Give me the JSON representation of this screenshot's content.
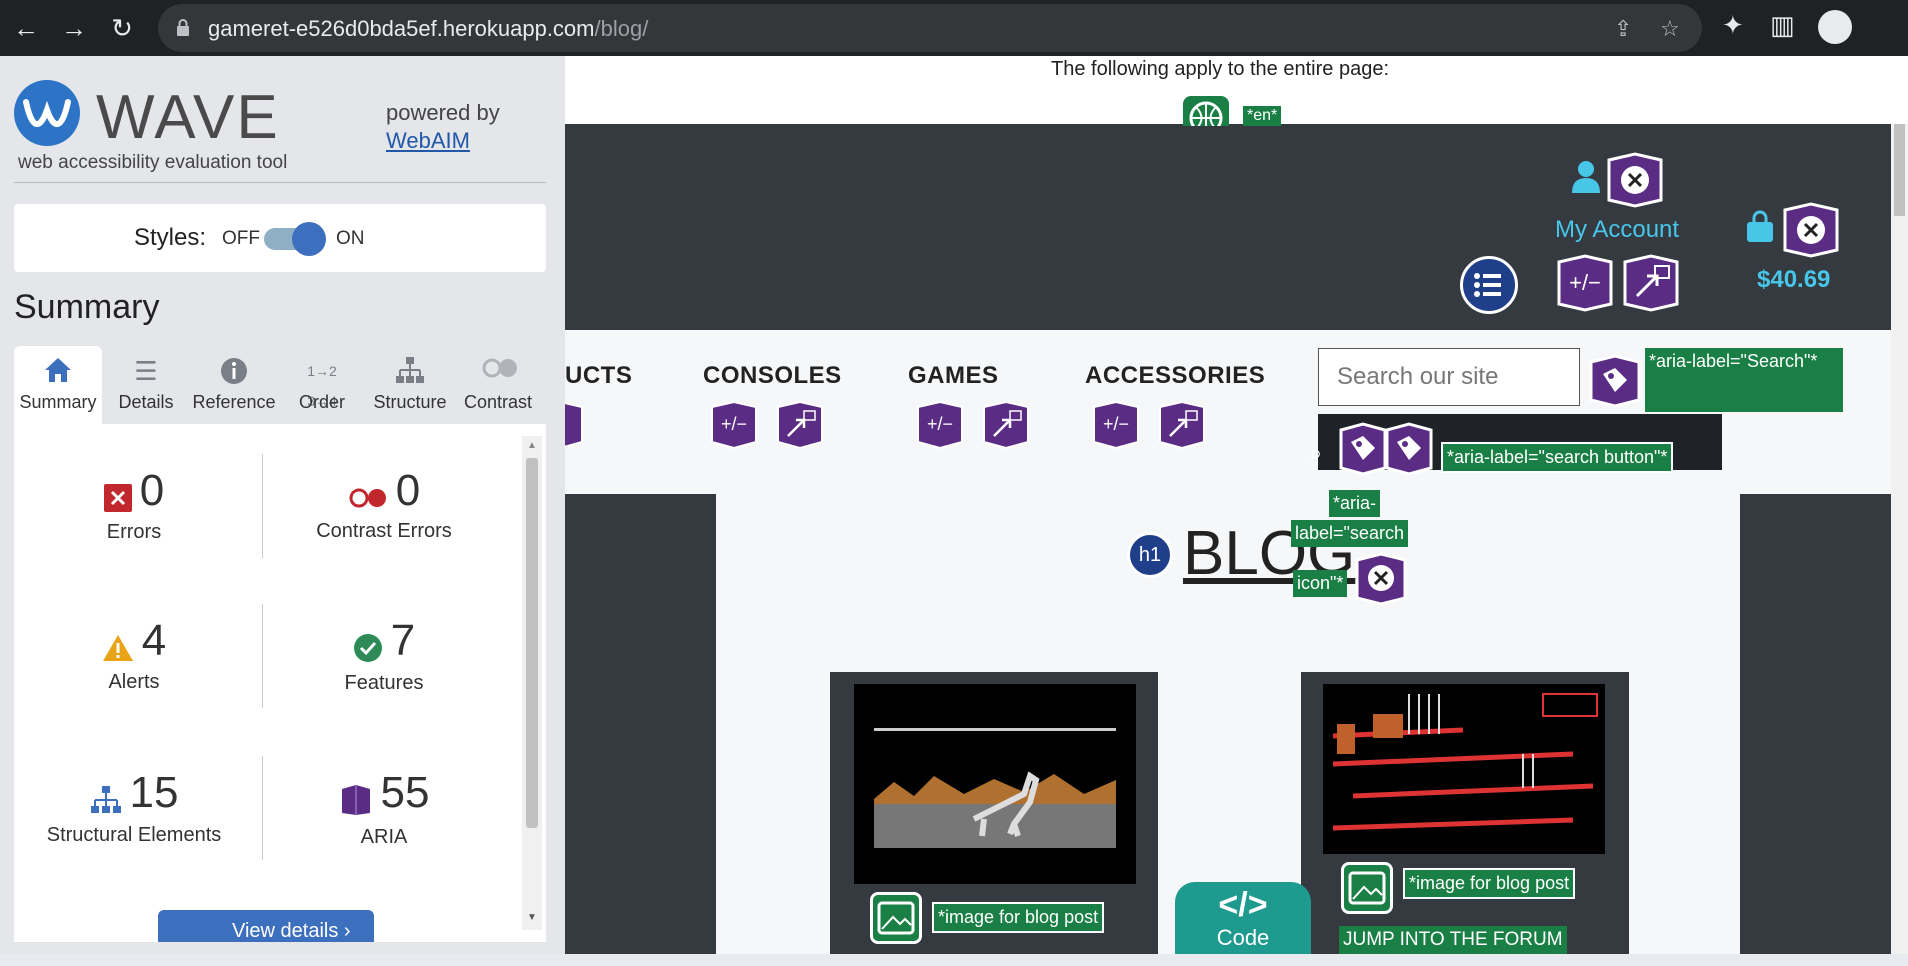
{
  "browser": {
    "url_host": "gameret-e526d0bda5ef.herokuapp.com",
    "url_path": "/blog/"
  },
  "wave": {
    "title": "WAVE",
    "subtitle": "web accessibility evaluation tool",
    "powered_by": "powered by",
    "webaim_link": "WebAIM",
    "styles_label": "Styles:",
    "styles_off": "OFF",
    "styles_on": "ON",
    "styles_state": "on",
    "summary_heading": "Summary",
    "tabs": [
      {
        "label": "Summary",
        "icon": "home-icon",
        "active": true
      },
      {
        "label": "Details",
        "icon": "list-icon",
        "active": false
      },
      {
        "label": "Reference",
        "icon": "info-icon",
        "active": false
      },
      {
        "label": "Order",
        "icon": "order-icon",
        "active": false
      },
      {
        "label": "Structure",
        "icon": "structure-icon",
        "active": false
      },
      {
        "label": "Contrast",
        "icon": "contrast-icon",
        "active": false
      }
    ],
    "stats": {
      "errors": {
        "count": "0",
        "label": "Errors",
        "color": "#c0282d"
      },
      "contrast_errors": {
        "count": "0",
        "label": "Contrast Errors",
        "color": "#c0282d"
      },
      "alerts": {
        "count": "4",
        "label": "Alerts",
        "color": "#e8a317"
      },
      "features": {
        "count": "7",
        "label": "Features",
        "color": "#2e8b57"
      },
      "structural": {
        "count": "15",
        "label": "Structural Elements",
        "color": "#3d6fbf"
      },
      "aria": {
        "count": "55",
        "label": "ARIA",
        "color": "#5b2c83"
      }
    },
    "view_details": "View details ›"
  },
  "page": {
    "entire_page_note": "The following apply to the entire page:",
    "lang_label": "*en*",
    "account_label": "My Account",
    "cart_total": "$40.69",
    "menu": [
      "UCTS",
      "CONSOLES",
      "GAMES",
      "ACCESSORIES"
    ],
    "search_placeholder": "Search our site",
    "aria_search": "*aria-label=\"Search\"*",
    "aria_search_button": "*aria-label=\"search button\"*",
    "aria_search_icon_1": "*aria-",
    "aria_search_icon_2": "label=\"search",
    "aria_search_icon_3": "icon\"*",
    "heading_level": "h1",
    "heading": "BLOG",
    "card1_alt": "*image for blog post",
    "card2_alt": "*image for blog post",
    "card2_title": "JUMP INTO THE FORUM",
    "code_symbol": "</>",
    "code_label": "Code",
    "plus_minus": "+/−"
  },
  "colors": {
    "aria_purple": "#5b2c83",
    "feature_green": "#1a7f45",
    "accent_cyan": "#48c6e8"
  }
}
